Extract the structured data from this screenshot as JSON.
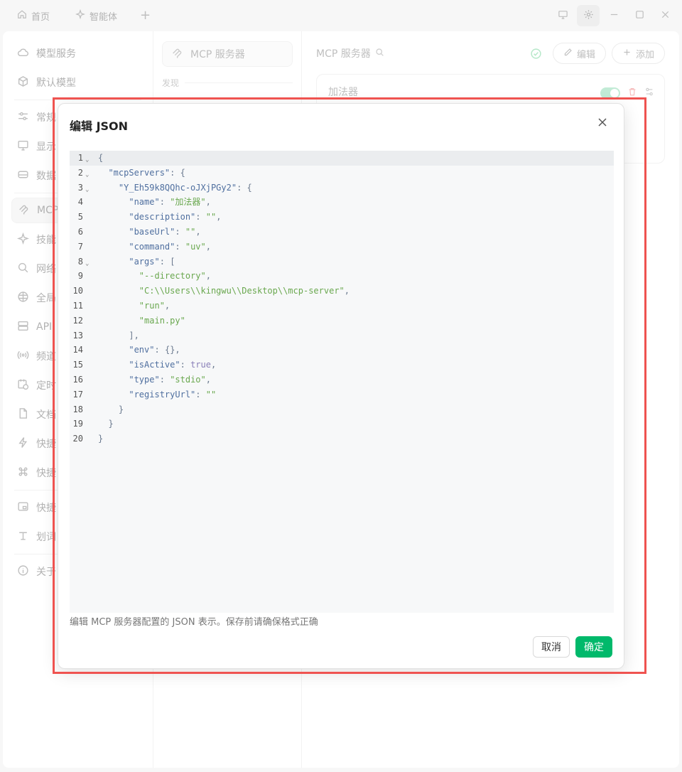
{
  "tabs": [
    {
      "label": "首页",
      "icon": "home-icon"
    },
    {
      "label": "智能体",
      "icon": "sparkle-icon"
    }
  ],
  "sidebar": {
    "items": [
      {
        "label": "模型服务",
        "icon": "cloud-icon"
      },
      {
        "label": "默认模型",
        "icon": "cube-icon"
      },
      {
        "label": "常规",
        "icon": "sliders-icon"
      },
      {
        "label": "显示",
        "icon": "monitor-icon"
      },
      {
        "label": "数据",
        "icon": "database-icon"
      },
      {
        "label": "MCP",
        "icon": "mcp-icon"
      },
      {
        "label": "技能",
        "icon": "sparkle-icon"
      },
      {
        "label": "网络",
        "icon": "search-icon"
      },
      {
        "label": "全局",
        "icon": "globe-icon"
      },
      {
        "label": "API",
        "icon": "server-icon"
      },
      {
        "label": "频道",
        "icon": "broadcast-icon"
      },
      {
        "label": "定时",
        "icon": "calendar-clock-icon"
      },
      {
        "label": "文档",
        "icon": "document-icon"
      },
      {
        "label": "快捷",
        "icon": "zap-icon"
      },
      {
        "label": "快捷",
        "icon": "command-icon"
      },
      {
        "label": "快捷",
        "icon": "window-icon"
      },
      {
        "label": "划词",
        "icon": "text-select-icon"
      },
      {
        "label": "关于",
        "icon": "info-icon"
      }
    ]
  },
  "midcol": {
    "pill_label": "MCP 服务器",
    "discover_label": "发现"
  },
  "rightcol": {
    "title": "MCP 服务器",
    "edit_label": "编辑",
    "add_label": "添加",
    "server_name": "加法器"
  },
  "modal": {
    "title": "编辑 JSON",
    "description": "编辑 MCP 服务器配置的 JSON 表示。保存前请确保格式正确",
    "cancel_label": "取消",
    "ok_label": "确定",
    "code_lines": [
      "{",
      "  \"mcpServers\": {",
      "    \"Y_Eh59k8QQhc-oJXjPGy2\": {",
      "      \"name\": \"加法器\",",
      "      \"description\": \"\",",
      "      \"baseUrl\": \"\",",
      "      \"command\": \"uv\",",
      "      \"args\": [",
      "        \"--directory\",",
      "        \"C:\\\\Users\\\\kingwu\\\\Desktop\\\\mcp-server\",",
      "        \"run\",",
      "        \"main.py\"",
      "      ],",
      "      \"env\": {},",
      "      \"isActive\": true,",
      "      \"type\": \"stdio\",",
      "      \"registryUrl\": \"\"",
      "    }",
      "  }",
      "}"
    ],
    "foldable_lines": [
      1,
      2,
      3,
      8
    ]
  },
  "colors": {
    "accent": "#00b96b",
    "highlight": "#ef5350"
  }
}
